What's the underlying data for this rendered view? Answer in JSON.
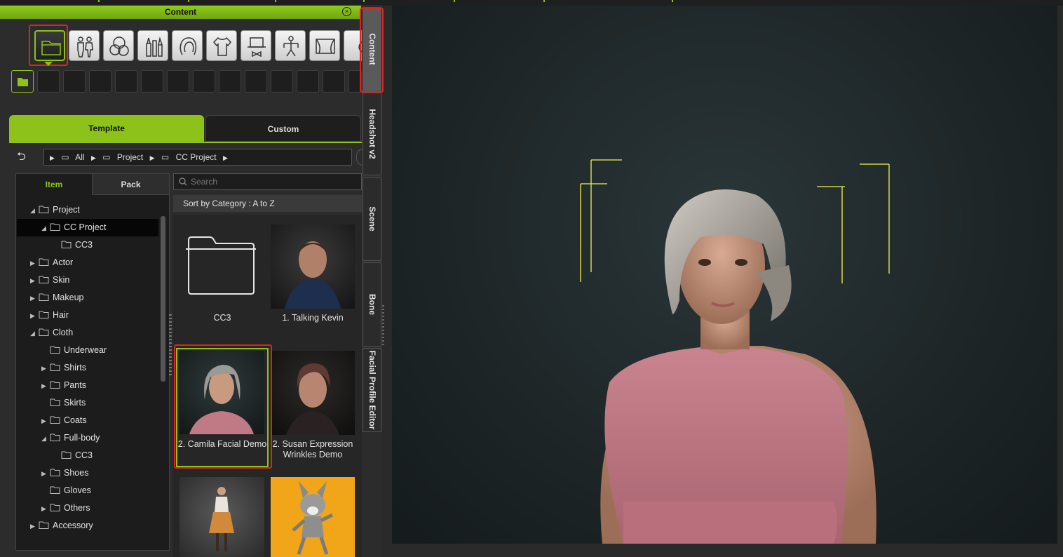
{
  "panel": {
    "title": "Content",
    "close_icon": "close-icon"
  },
  "categories": [
    {
      "name": "folder-icon",
      "active": true
    },
    {
      "name": "actor-icon"
    },
    {
      "name": "skin-icon"
    },
    {
      "name": "makeup-icon"
    },
    {
      "name": "hair-icon"
    },
    {
      "name": "cloth-icon"
    },
    {
      "name": "accessory-icon"
    },
    {
      "name": "pose-icon"
    },
    {
      "name": "stage-icon"
    },
    {
      "name": "more-icon"
    }
  ],
  "main_tabs": {
    "template": "Template",
    "custom": "Custom"
  },
  "breadcrumb": {
    "all": "All",
    "project": "Project",
    "cc_project": "CC Project"
  },
  "sub_tabs": {
    "item": "Item",
    "pack": "Pack"
  },
  "tree": [
    {
      "label": "Project",
      "indent": 0,
      "expanded": true,
      "icon": "folder-icon"
    },
    {
      "label": "CC Project",
      "indent": 1,
      "expanded": true,
      "icon": "folder-icon",
      "selected": true
    },
    {
      "label": "CC3",
      "indent": 2,
      "icon": "folder-icon"
    },
    {
      "label": "Actor",
      "indent": 0,
      "icon": "actor-icon"
    },
    {
      "label": "Skin",
      "indent": 0,
      "icon": "skin-icon"
    },
    {
      "label": "Makeup",
      "indent": 0,
      "icon": "makeup-icon"
    },
    {
      "label": "Hair",
      "indent": 0,
      "icon": "hair-icon"
    },
    {
      "label": "Cloth",
      "indent": 0,
      "expanded": true,
      "icon": "cloth-icon"
    },
    {
      "label": "Underwear",
      "indent": 1,
      "icon": "underwear-icon"
    },
    {
      "label": "Shirts",
      "indent": 1,
      "icon": "shirt-icon"
    },
    {
      "label": "Pants",
      "indent": 1,
      "icon": "pants-icon"
    },
    {
      "label": "Skirts",
      "indent": 1,
      "icon": "skirt-icon"
    },
    {
      "label": "Coats",
      "indent": 1,
      "icon": "coat-icon"
    },
    {
      "label": "Full-body",
      "indent": 1,
      "expanded": true,
      "icon": "fullbody-icon"
    },
    {
      "label": "CC3",
      "indent": 2,
      "icon": "folder-icon"
    },
    {
      "label": "Shoes",
      "indent": 1,
      "icon": "shoe-icon"
    },
    {
      "label": "Gloves",
      "indent": 1,
      "icon": "glove-icon"
    },
    {
      "label": "Others",
      "indent": 1,
      "icon": "others-icon"
    },
    {
      "label": "Accessory",
      "indent": 0,
      "icon": "accessory-icon"
    }
  ],
  "search": {
    "placeholder": "Search"
  },
  "sort": {
    "label": "Sort by Category : A to Z"
  },
  "items": [
    {
      "caption": "CC3"
    },
    {
      "caption": "1. Talking Kevin"
    },
    {
      "caption": "2. Camila Facial Demo",
      "selected": true
    },
    {
      "caption": "2. Susan Expression Wrinkles Demo"
    },
    {
      "caption": ""
    },
    {
      "caption": ""
    }
  ],
  "side_tabs": [
    "Content",
    "Headshot v2",
    "Scene",
    "Bone",
    "Facial Profile Editor"
  ],
  "colors": {
    "accent": "#8cc21a",
    "highlight": "#e02222",
    "viewport_bg": "#1e2628"
  }
}
